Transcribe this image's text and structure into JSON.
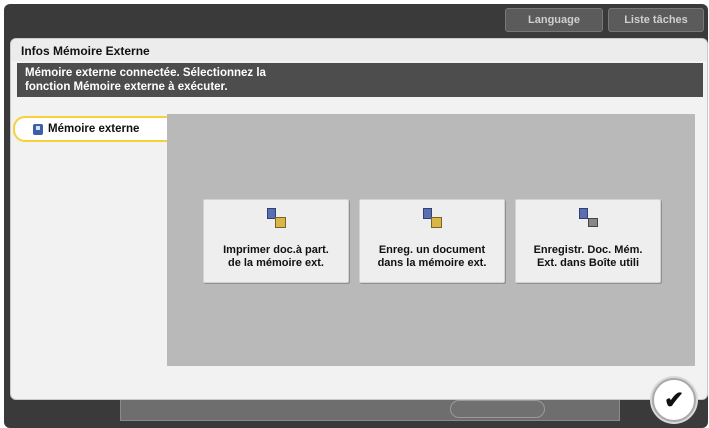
{
  "top_bar": {
    "language_label": "Language",
    "jobs_label": "Liste tâches"
  },
  "dialog": {
    "title": "Infos Mémoire Externe",
    "message_line1": "Mémoire externe connectée. Sélectionnez la",
    "message_line2": "fonction Mémoire externe à exécuter."
  },
  "nav": {
    "item_label": "Mémoire externe",
    "item_icon": "memory-icon"
  },
  "functions": [
    {
      "label": "Imprimer doc.à part.\nde la mémoire ext.",
      "icon": "print-from-memory-icon"
    },
    {
      "label": "Enreg. un document\ndans la mémoire ext.",
      "icon": "save-to-memory-icon"
    },
    {
      "label": "Enregistr. Doc. Mém.\nExt. dans Boîte utili",
      "icon": "save-to-box-icon"
    }
  ],
  "ok": {
    "glyph": "✔"
  },
  "colors": {
    "accent": "#f5d23a",
    "panel": "#b9b9b9",
    "message_bar": "#4d4d4d"
  }
}
